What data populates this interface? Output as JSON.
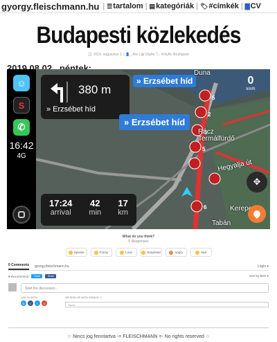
{
  "nav": {
    "site": "gyorgy.fleischmann.hu",
    "sep": "|",
    "items": [
      {
        "icon": "☰",
        "label": "tartalom"
      },
      {
        "icon": "▤",
        "label": "kategóriák"
      },
      {
        "icon": "🏷",
        "label": "#címkék"
      },
      {
        "icon": "▇",
        "label": "CV"
      }
    ]
  },
  "post": {
    "title": "Budapesti közlekedés",
    "meta": "🕓 2019. augusztus 2. | 👤 _flex | ▤ Cityfie  🏷 #cityfie #budapest",
    "date": "2019.08.02., péntek:"
  },
  "nav_app": {
    "clock": "16:42",
    "network": "4G",
    "turn_distance": "380 m",
    "turn_street": "» Erzsébet híd",
    "banner_top": "» Erzsébet híd",
    "banner_mid": "» Erzsébet híd",
    "speed_value": "0",
    "speed_unit": "km/h",
    "eta": [
      {
        "value": "17:24",
        "unit": "arrival"
      },
      {
        "value": "42",
        "unit": "min"
      },
      {
        "value": "17",
        "unit": "km"
      }
    ],
    "map_labels": [
      "Duna",
      "Rácz Termálfürdő",
      "Hegyalja út",
      "Tabán",
      "Kerepesi"
    ],
    "jam_counts": [
      "5",
      "2",
      "5",
      "5",
      "1",
      "1",
      "6"
    ],
    "km_label": "km/h"
  },
  "disqus": {
    "question": "What do you think?",
    "responses": "0 Responses",
    "reactions": [
      "Upvote",
      "Funny",
      "Love",
      "Surprised",
      "Angry",
      "Sad"
    ],
    "tab_comments": "0 Comments",
    "tab_site": "gyorgy.fleischmann.hu",
    "login": "Login ▾",
    "recommend": "♥ Recommend",
    "tweet": "Tweet",
    "share": "Share",
    "sort": "Sort by Best ▾",
    "placeholder": "Start the discussion…",
    "login_with": "LOG IN WITH",
    "signup": "OR SIGN UP WITH DISQUS ⓘ",
    "name_placeholder": "Name"
  },
  "footer": {
    "text": "Nincs jog fenntartva -= FLEISCHMANN =- No rights reserved",
    "star": "☆"
  }
}
